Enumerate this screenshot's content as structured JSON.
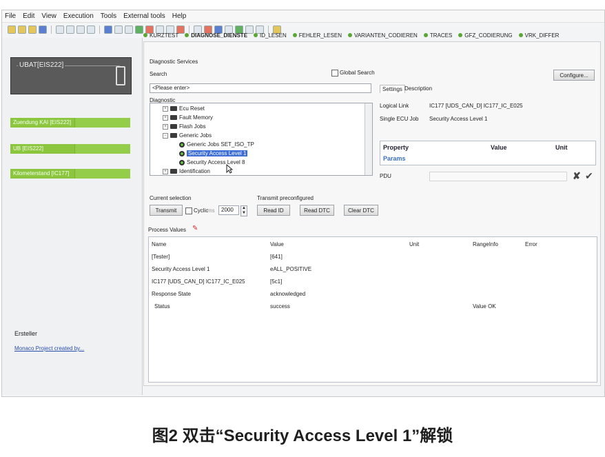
{
  "menu": [
    "File",
    "Edit",
    "View",
    "Execution",
    "Tools",
    "External tools",
    "Help"
  ],
  "left": {
    "ubat_label": "UBAT[EIS222]",
    "bars": [
      "Zuendung KAI [EIS222]",
      "UB [EIS222]",
      "Kilometerstand [IC177]"
    ],
    "creator_label": "Ersteller",
    "creator_link": "Monaco Project created by..."
  },
  "tabs": [
    "KURZTEST",
    "DIAGNOSE_DIENSTE",
    "ID_LESEN",
    "FEHLER_LESEN",
    "VARIANTEN_CODIEREN",
    "TRACES",
    "GFZ_CODIERUNG",
    "VRK_DIFFER"
  ],
  "diag": {
    "group_title": "Diagnostic Services",
    "search_label": "Search",
    "global_search": "Global Search",
    "search_placeholder": "<Please enter>",
    "diagnostic_label": "Diagnostic",
    "tree": [
      "Ecu Reset",
      "Fault Memory",
      "Flash Jobs",
      "Generic Jobs",
      "Generic Jobs SET_ISO_TP",
      "Security Access Level 1",
      "Security Access Level 8",
      "Identification"
    ]
  },
  "right": {
    "configure": "Configure...",
    "tab_settings": "Settings",
    "tab_description": "Description",
    "logical_link_label": "Logical Link",
    "logical_link_value": "IC177 [UDS_CAN_D] IC177_IC_E025",
    "single_ecu_label": "Single ECU Job",
    "single_ecu_value": "Security Access Level 1",
    "col_property": "Property",
    "col_value": "Value",
    "col_unit": "Unit",
    "params": "Params",
    "pdu_label": "PDU"
  },
  "current": {
    "title": "Current selection",
    "transmit": "Transmit",
    "cyclic": "Cyclic",
    "ms": "ms",
    "cycle_value": "2000",
    "preconf_title": "Transmit preconfigured",
    "read_id": "Read ID",
    "read_dtc": "Read DTC",
    "clear_dtc": "Clear DTC"
  },
  "process": {
    "title": "Process Values",
    "headers": [
      "Name",
      "Value",
      "Unit",
      "RangeInfo",
      "Error"
    ],
    "rows": [
      {
        "name": "[Tester]",
        "value": "[641]",
        "range": ""
      },
      {
        "name": "Security Access Level 1",
        "value": "eALL_POSITIVE",
        "range": ""
      },
      {
        "name": "IC177 [UDS_CAN_D] IC177_IC_E025",
        "value": "[5c1]",
        "range": ""
      },
      {
        "name": "Response State",
        "value": "acknowledged",
        "range": ""
      },
      {
        "name": "Status",
        "value": "success",
        "range": "Value OK"
      }
    ]
  },
  "caption": "图2 双击“Security Access Level 1”解锁"
}
